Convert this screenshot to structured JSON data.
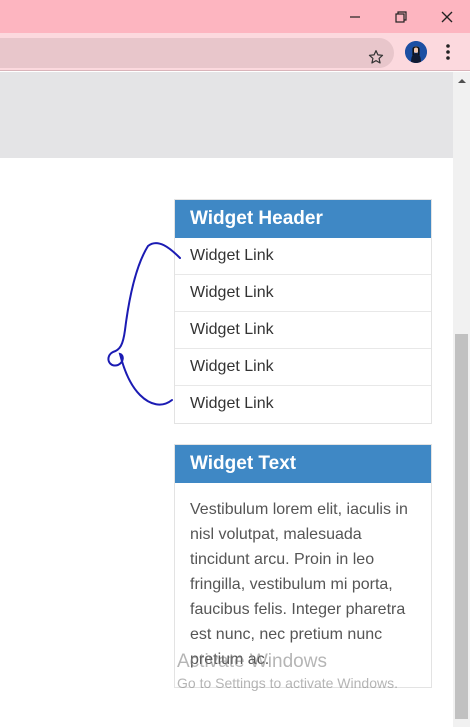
{
  "browser": {
    "controls": {
      "minimize_icon": "minimize-icon",
      "restore_icon": "restore-icon",
      "close_icon": "close-icon"
    },
    "toolbar": {
      "bookmark_icon": "star-icon",
      "profile_icon": "avatar",
      "menu_icon": "kebab-menu-icon"
    },
    "colors": {
      "titlebar": "#fdb5c0",
      "toolbar": "#fcd9de",
      "omnibox": "#e8c6cb"
    }
  },
  "page": {
    "links_widget": {
      "header": "Widget Header",
      "links": [
        "Widget Link",
        "Widget Link",
        "Widget Link",
        "Widget Link",
        "Widget Link"
      ]
    },
    "text_widget": {
      "header": "Widget Text",
      "body": "Vestibulum lorem elit, iaculis in nisl volutpat, malesuada tincidunt arcu. Proin in leo fringilla, vestibulum mi porta, faucibus felis. Integer pharetra est nunc, nec pretium nunc pretium ac."
    },
    "accent_color": "#3f88c5"
  },
  "overlay": {
    "watermark_title": "Activate Windows",
    "watermark_subtitle": "Go to Settings to activate Windows."
  }
}
